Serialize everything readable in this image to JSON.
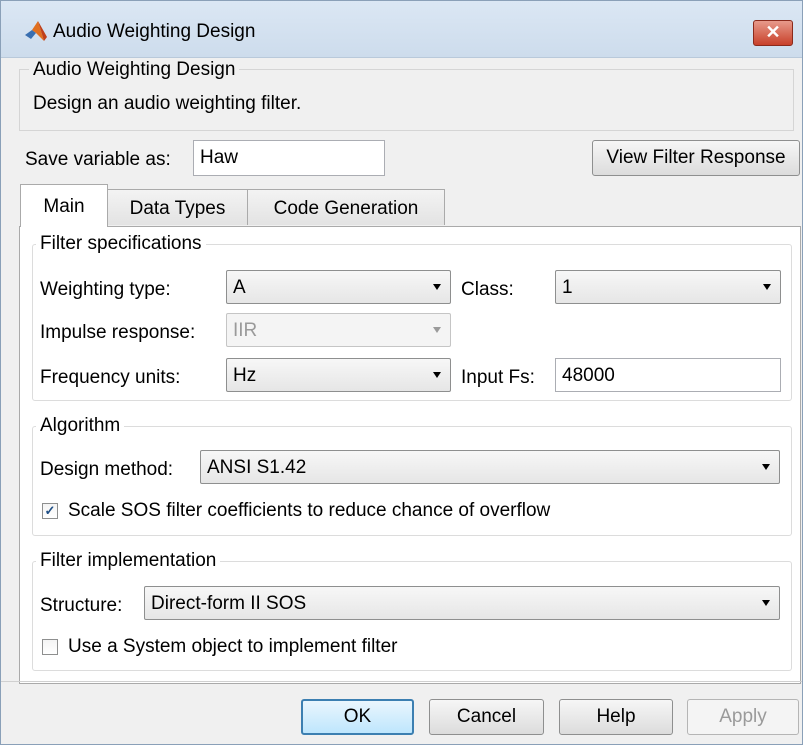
{
  "window": {
    "title": "Audio Weighting Design",
    "close_label": "✕"
  },
  "description": {
    "group_label": "Audio Weighting Design",
    "text": "Design an audio weighting filter."
  },
  "save": {
    "label": "Save variable as:",
    "value": "Haw"
  },
  "view_button": "View Filter Response",
  "tabs": [
    {
      "label": "Main",
      "active": true
    },
    {
      "label": "Data Types",
      "active": false
    },
    {
      "label": "Code Generation",
      "active": false
    }
  ],
  "filter_specs": {
    "group_label": "Filter specifications",
    "weighting_type": {
      "label": "Weighting type:",
      "value": "A"
    },
    "class": {
      "label": "Class:",
      "value": "1"
    },
    "impulse_response": {
      "label": "Impulse response:",
      "value": "IIR"
    },
    "frequency_units": {
      "label": "Frequency units:",
      "value": "Hz"
    },
    "input_fs": {
      "label": "Input Fs:",
      "value": "48000"
    }
  },
  "algorithm": {
    "group_label": "Algorithm",
    "design_method": {
      "label": "Design method:",
      "value": "ANSI S1.42"
    },
    "scale_sos": {
      "label": "Scale SOS filter coefficients to reduce chance of overflow",
      "checked": true
    }
  },
  "implementation": {
    "group_label": "Filter implementation",
    "structure": {
      "label": "Structure:",
      "value": "Direct-form II SOS"
    },
    "system_object": {
      "label": "Use a System object to implement filter",
      "checked": false
    }
  },
  "footer": {
    "ok": "OK",
    "cancel": "Cancel",
    "help": "Help",
    "apply": "Apply"
  },
  "icons": {
    "app": "matlab-logo-icon",
    "close": "close-icon",
    "dropdown": "chevron-down-icon",
    "check": "checkmark-icon"
  },
  "colors": {
    "close_button": "#c8402a",
    "default_button_border": "#3c7fb1",
    "titlebar": "#d4e2f1"
  }
}
